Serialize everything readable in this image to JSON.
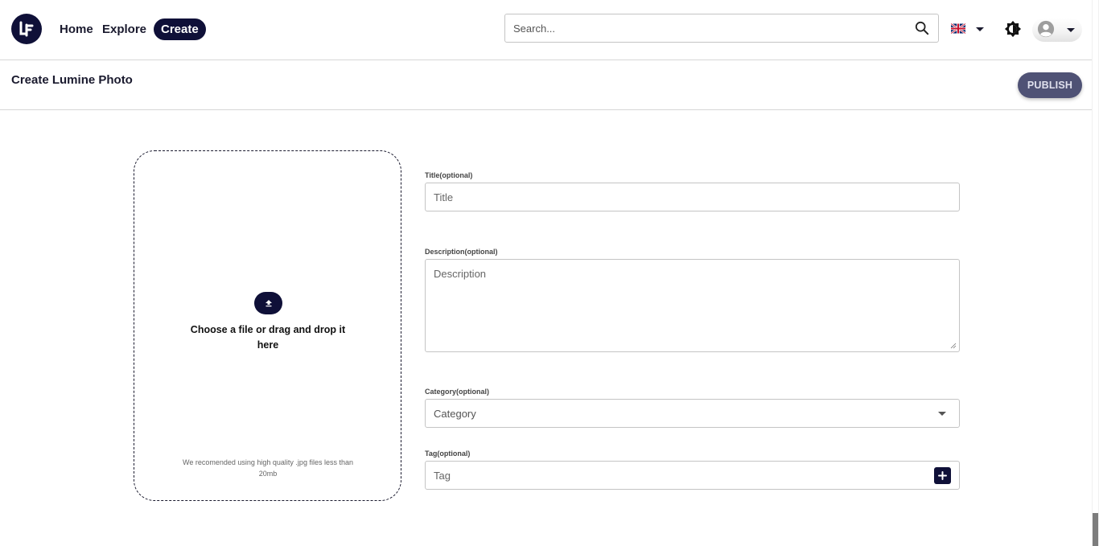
{
  "brand": {
    "logo_text": "LP"
  },
  "nav": {
    "home": "Home",
    "explore": "Explore",
    "create": "Create"
  },
  "search": {
    "placeholder": "Search...",
    "value": ""
  },
  "header": {
    "language_icon": "uk-flag-icon",
    "theme_icon": "brightness-icon",
    "avatar_icon": "user-avatar-icon"
  },
  "subheader": {
    "title": "Create Lumine Photo",
    "publish_label": "PUBLISH"
  },
  "upload": {
    "prompt": "Choose a file or drag and drop it here",
    "hint": "We recomended using high quality .jpg files less than 20mb",
    "icon": "upload-icon"
  },
  "form": {
    "title": {
      "label": "Title(optional)",
      "placeholder": "Title",
      "value": ""
    },
    "description": {
      "label": "Description(optional)",
      "placeholder": "Description",
      "value": ""
    },
    "category": {
      "label": "Category(optional)",
      "value": "Category"
    },
    "tag": {
      "label": "Tag(optional)",
      "placeholder": "Tag",
      "value": ""
    }
  },
  "colors": {
    "brand_navy": "#0f1038",
    "publish_bg": "#4f5275",
    "border": "#c4c4c4"
  }
}
